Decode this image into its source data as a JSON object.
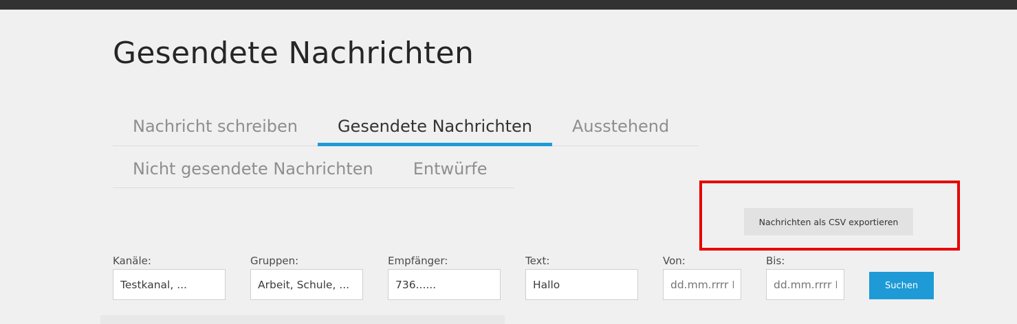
{
  "page": {
    "title": "Gesendete Nachrichten"
  },
  "tabs": [
    {
      "label": "Nachricht schreiben",
      "active": false
    },
    {
      "label": "Gesendete Nachrichten",
      "active": true
    },
    {
      "label": "Ausstehend",
      "active": false
    },
    {
      "label": "Nicht gesendete Nachrichten",
      "active": false
    },
    {
      "label": "Entwürfe",
      "active": false
    }
  ],
  "export": {
    "label": "Nachrichten als CSV exportieren"
  },
  "filters": {
    "channels": {
      "label": "Kanäle:",
      "value": "Testkanal, ..."
    },
    "groups": {
      "label": "Gruppen:",
      "value": "Arbeit, Schule, ..."
    },
    "recipients": {
      "label": "Empfänger:",
      "value": "736......"
    },
    "text": {
      "label": "Text:",
      "value": "Hallo"
    },
    "from": {
      "label": "Von:",
      "placeholder": "dd.mm.rrrr I"
    },
    "to": {
      "label": "Bis:",
      "placeholder": "dd.mm.rrrr I"
    }
  },
  "search": {
    "label": "Suchen"
  },
  "colors": {
    "accent": "#1e9ad6",
    "highlight": "#e60000",
    "topbar": "#323232",
    "background": "#f0f0f0"
  }
}
